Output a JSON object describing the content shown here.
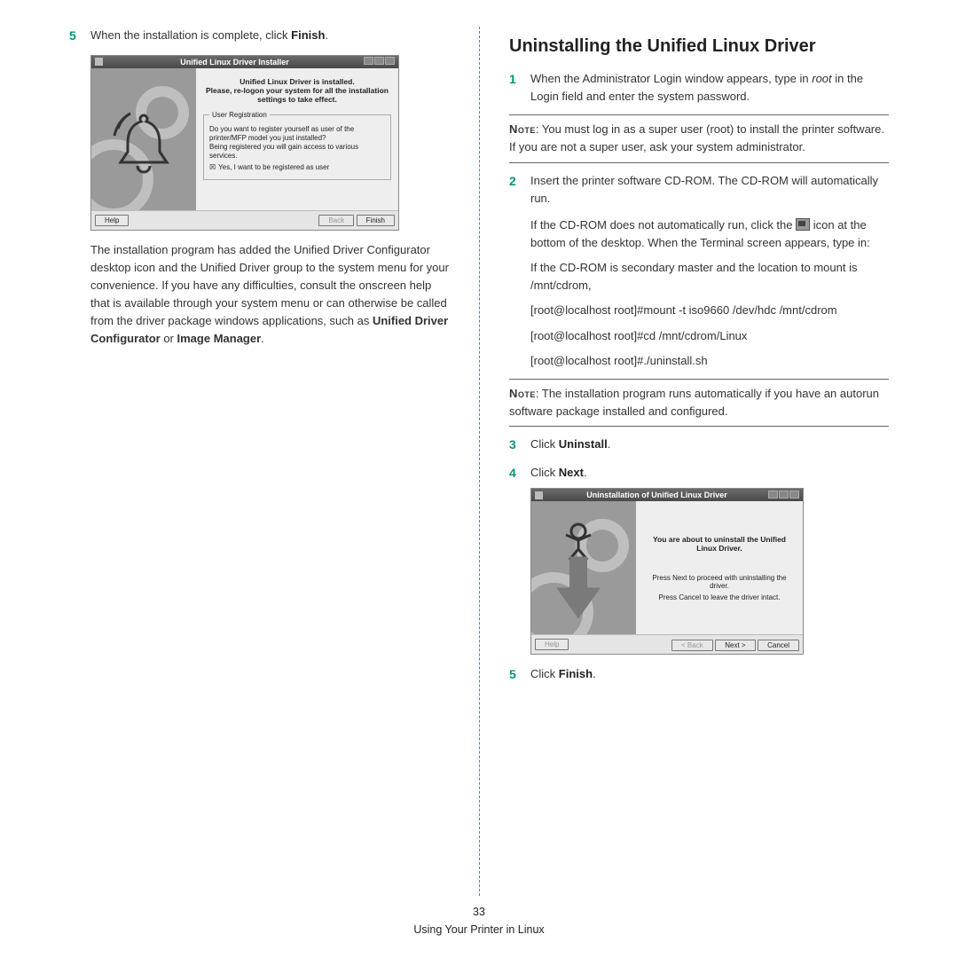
{
  "left": {
    "step5_num": "5",
    "step5_text_a": "When the installation is complete, click ",
    "step5_text_b": "Finish",
    "step5_text_c": ".",
    "mock1": {
      "title": "Unified Linux Driver Installer",
      "msg1": "Unified Linux Driver is installed.",
      "msg2": "Please, re-logon your system for all the installation settings to take effect.",
      "group_title": "User Registration",
      "group_line1": "Do you want to register yourself as user of the printer/MFP model you just installed?",
      "group_line2": "Being registered you will gain access to various services.",
      "group_check": "Yes, I want to be registered as user",
      "btn_help": "Help",
      "btn_back": "Back",
      "btn_finish": "Finish"
    },
    "para_a": "The installation program has added the Unified Driver Configurator desktop icon and the Unified Driver group to the system menu for your convenience. If you have any difficulties, consult the onscreen help that is available through your system menu or can otherwise be called from the driver package windows applications, such as ",
    "para_b": "Unified Driver Configurator",
    "para_c": " or ",
    "para_d": "Image Manager",
    "para_e": "."
  },
  "right": {
    "heading": "Uninstalling the Unified Linux Driver",
    "s1_num": "1",
    "s1_a": "When the Administrator Login window appears, type in ",
    "s1_b": "root",
    "s1_c": " in the Login field and enter the system password.",
    "note1_label": "Note",
    "note1_text": ": You must log in as a super user (root) to install the printer software. If you are not a super user, ask your system administrator.",
    "s2_num": "2",
    "s2_text": "Insert the printer software CD-ROM. The CD-ROM will automatically run.",
    "sub1_a": "If the CD-ROM does not automatically run, click the ",
    "sub1_b": " icon at the bottom of the desktop. When the Terminal screen appears, type in:",
    "sub2": "If the CD-ROM is secondary master and the location to mount is /mnt/cdrom,",
    "sub3": "[root@localhost root]#mount -t iso9660 /dev/hdc /mnt/cdrom",
    "sub4": "[root@localhost root]#cd /mnt/cdrom/Linux",
    "sub5": "[root@localhost root]#./uninstall.sh",
    "note2_label": "Note",
    "note2_text": ": The installation program runs automatically if you have an autorun software package installed and configured.",
    "s3_num": "3",
    "s3_a": "Click ",
    "s3_b": "Uninstall",
    "s3_c": ".",
    "s4_num": "4",
    "s4_a": "Click ",
    "s4_b": "Next",
    "s4_c": ".",
    "mock2": {
      "title": "Uninstallation of Unified Linux Driver",
      "line": "You are about to uninstall the Unified Linux Driver.",
      "sub1": "Press Next to proceed with uninstalling the driver.",
      "sub2": "Press Cancel to leave the driver intact.",
      "btn_help": "Help",
      "btn_back": "< Back",
      "btn_next": "Next >",
      "btn_cancel": "Cancel"
    },
    "s5_num": "5",
    "s5_a": "Click ",
    "s5_b": "Finish",
    "s5_c": "."
  },
  "footer": {
    "page": "33",
    "section": "Using Your Printer in Linux"
  }
}
